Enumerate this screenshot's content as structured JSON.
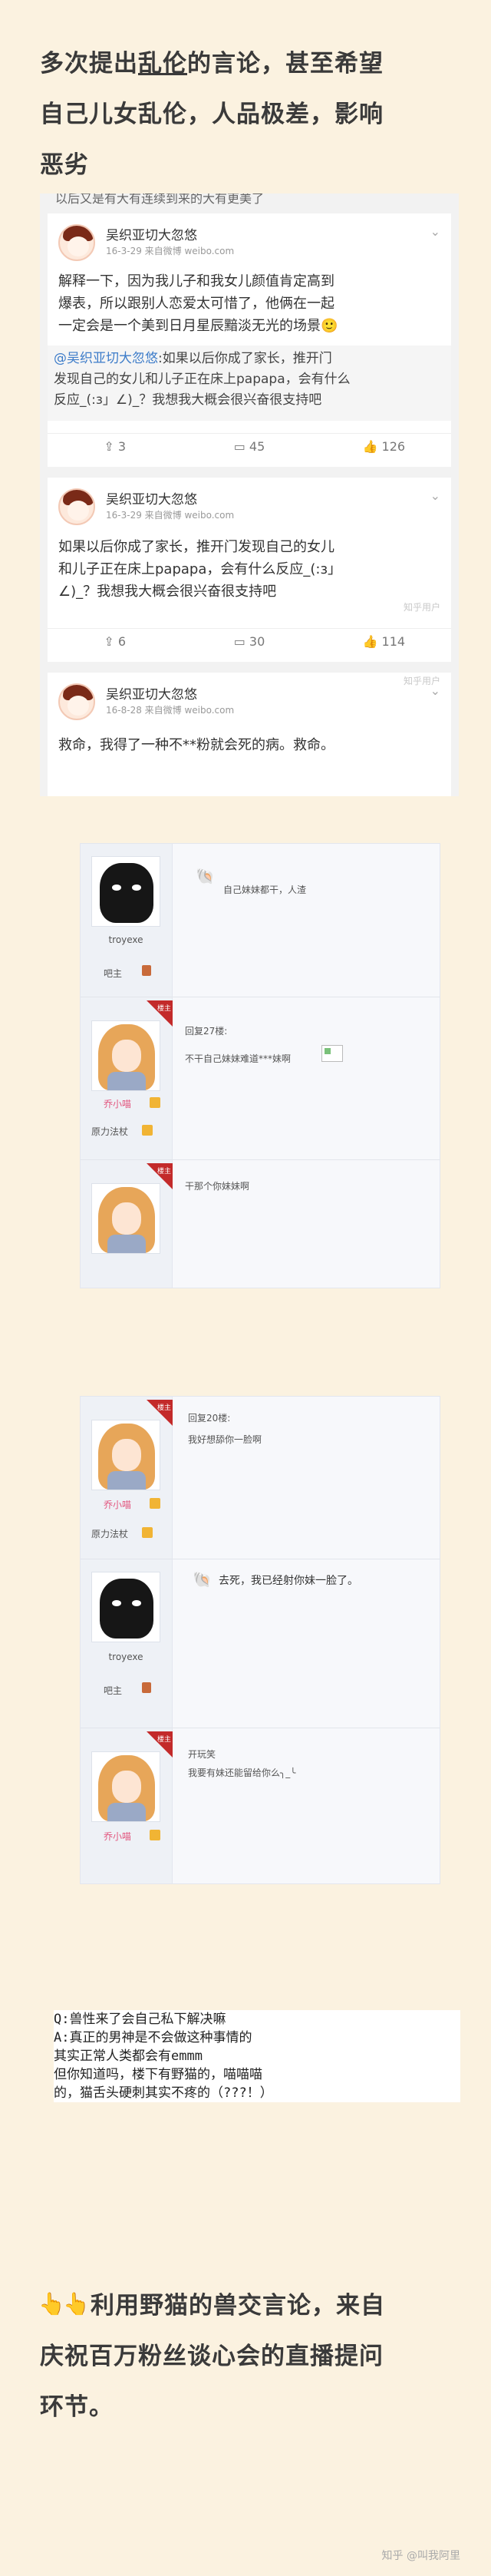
{
  "intro": {
    "line1_prefix": "多次提出",
    "line1_link": "乱伦",
    "line1_suffix": "的言论，甚至希望",
    "line2": "自己儿女乱伦，人品极差，影响",
    "line3": "恶劣"
  },
  "weibo": {
    "cut_top_text": "以后又是有大有连续到来的大有更美了",
    "cards": [
      {
        "name": "吴织亚切大忽悠",
        "meta": "16-3-29  来自微博 weibo.com",
        "text_lines": [
          "解释一下，因为我儿子和我女儿颜值肯定高到",
          "爆表，所以跟别人恋爱太可惜了，他俩在一起",
          "一定会是一个美到日月星辰黯淡无光的场景"
        ],
        "emoji": "🙂",
        "quote_author": "@吴织亚切大忽悠",
        "quote_lines": [
          ":如果以后你成了家长，推开门",
          "发现自己的女儿和儿子正在床上papapa，会有什么",
          "反应_(:з」∠)_？我想我大概会很兴奋很支持吧"
        ],
        "actions": [
          "3",
          "45",
          "126"
        ]
      },
      {
        "name": "吴织亚切大忽悠",
        "meta": "16-3-29  来自微博 weibo.com",
        "text_lines": [
          "如果以后你成了家长，推开门发现自己的女儿",
          "和儿子正在床上papapa，会有什么反应_(:з」",
          "∠)_？我想我大概会很兴奋很支持吧"
        ],
        "actions": [
          "6",
          "30",
          "114"
        ]
      },
      {
        "name": "吴织亚切大忽悠",
        "meta": "16-8-28  来自微博 weibo.com",
        "text_lines": [
          "救命，我得了一种不**粉就会死的病。救命。"
        ]
      }
    ],
    "watermarks": [
      "知乎用户",
      "知乎用户"
    ]
  },
  "forum1": {
    "posts": [
      {
        "user": "troyexe",
        "rank": "吧主",
        "text": "自己妹妹都干，人渣",
        "emo": "🐚"
      },
      {
        "user": "乔小喵",
        "rank": "原力法杖",
        "reply": "回复27楼:",
        "text": "不干自己妹妹难道***妹啊",
        "ribbon": "楼主"
      },
      {
        "user": "",
        "rank": "",
        "text": "干那个你妹妹啊",
        "ribbon": "楼主"
      }
    ]
  },
  "forum2": {
    "posts": [
      {
        "user": "乔小喵",
        "rank": "原力法杖",
        "reply": "回复20楼:",
        "text": "我好想舔你一脸啊",
        "ribbon": "楼主"
      },
      {
        "user": "troyexe",
        "rank": "吧主",
        "text": "去死，我已经射你妹一脸了。",
        "emo": "🐚"
      },
      {
        "user": "乔小喵",
        "rank": "",
        "reply": "开玩笑",
        "text": "我要有妹还能留给你么╮_╰",
        "ribbon": "楼主"
      }
    ]
  },
  "qa": {
    "lines": [
      "Q:兽性来了会自己私下解决嘛",
      "A:真正的男神是不会做这种事情的",
      "   其实正常人类都会有emmm",
      "   但你知道吗，楼下有野猫的，喵喵喵",
      "   的，猫舌头硬刺其实不疼的（???！）"
    ]
  },
  "bottom": {
    "emoji": "👆",
    "line1": "利用野猫的兽交言论，来自",
    "line2": "庆祝百万粉丝谈心会的直播提问",
    "line3": "环节。",
    "footer": "知乎 @叫我阿里"
  },
  "colors": {
    "background": "#fbf2e0",
    "link": "#3d7cc9",
    "ribbon": "#c32a2a",
    "pink_user": "#e2557e"
  }
}
